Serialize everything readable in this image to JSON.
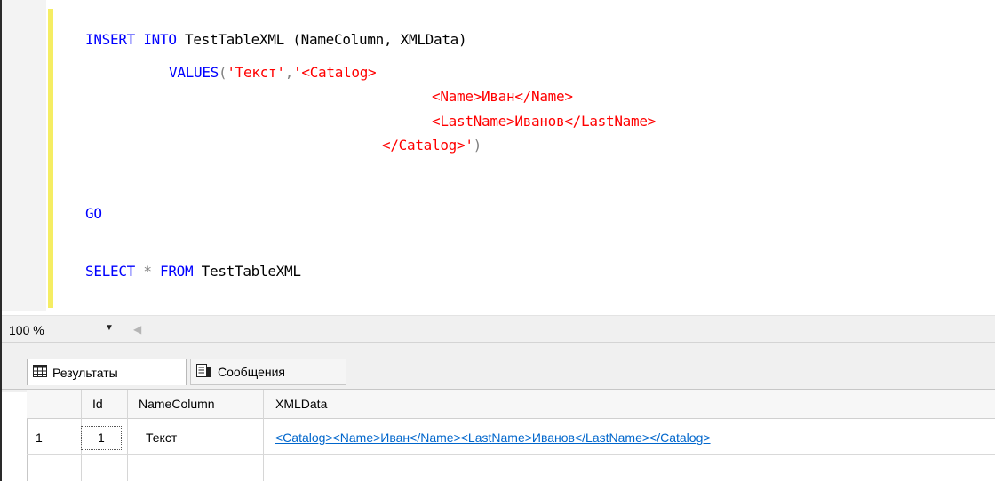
{
  "editor": {
    "line1": {
      "kw1": "INSERT",
      "kw2": "INTO",
      "rest": " TestTableXML (NameColumn, XMLData)"
    },
    "line2": {
      "kw": "VALUES",
      "open": "(",
      "str1": "'Текст'",
      "comma": ",",
      "str2": "'<Catalog>"
    },
    "line3": {
      "str": "<Name>Иван</Name>"
    },
    "line4": {
      "str": "<LastName>Иванов</LastName>"
    },
    "line5": {
      "str": "</Catalog>'",
      "close": ")"
    },
    "line6": {
      "kw": "GO"
    },
    "line7": {
      "kw1": "SELECT",
      "star": " * ",
      "kw2": "FROM",
      "rest": " TestTableXML"
    }
  },
  "zoom": {
    "value": "100 %",
    "dropdown": "▼",
    "scroll_left": "◀"
  },
  "tabs": [
    {
      "label": "Результаты",
      "icon": "grid-icon"
    },
    {
      "label": "Сообщения",
      "icon": "messages-icon"
    }
  ],
  "grid": {
    "columns": [
      "Id",
      "NameColumn",
      "XMLData"
    ],
    "rows": [
      {
        "row_num": "1",
        "id": "1",
        "name": "Текст",
        "xml": "<Catalog><Name>Иван</Name><LastName>Иванов</LastName></Catalog>"
      }
    ]
  },
  "colors": {
    "keyword": "#0000ff",
    "string": "#ff0000",
    "link": "#0066cc",
    "change_bar": "#f5ed63"
  }
}
